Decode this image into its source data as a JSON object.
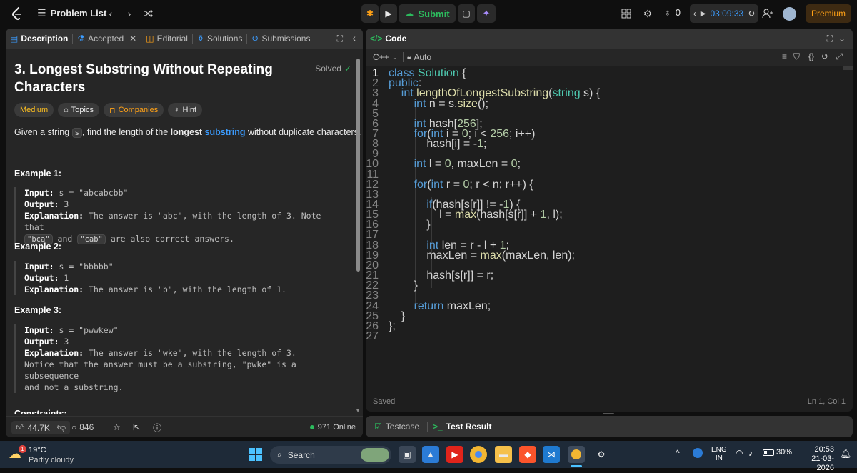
{
  "topbar": {
    "problem_list": "Problem List",
    "submit": "Submit",
    "streak": "0",
    "timer": "03:09:33",
    "premium": "Premium"
  },
  "description_panel": {
    "tabs": [
      {
        "label": "Description"
      },
      {
        "label": "Accepted"
      },
      {
        "label": "Editorial"
      },
      {
        "label": "Solutions"
      },
      {
        "label": "Submissions"
      }
    ],
    "title": "3. Longest Substring Without Repeating Characters",
    "status": "Solved",
    "tags": {
      "difficulty": "Medium",
      "topics": "Topics",
      "companies": "Companies",
      "hint": "Hint"
    },
    "statement": {
      "pre": "Given a string ",
      "var": "s",
      "mid": ", find the length of the ",
      "bold": "longest",
      "link": "substring",
      "post": " without duplicate characters."
    },
    "examples": [
      {
        "title": "Example 1:",
        "input_label": "Input:",
        "input": "s = \"abcabcbb\"",
        "output_label": "Output:",
        "output": "3",
        "explanation_label": "Explanation:",
        "explanation": "The answer is \"abc\", with the length of 3. Note that",
        "code1": "\"bca\"",
        "and": "and",
        "code2": "\"cab\"",
        "tail": "are also correct answers."
      },
      {
        "title": "Example 2:",
        "input_label": "Input:",
        "input": "s = \"bbbbb\"",
        "output_label": "Output:",
        "output": "1",
        "explanation_label": "Explanation:",
        "explanation": "The answer is \"b\", with the length of 1."
      },
      {
        "title": "Example 3:",
        "input_label": "Input:",
        "input": "s = \"pwwkew\"",
        "output_label": "Output:",
        "output": "3",
        "explanation_label": "Explanation:",
        "explanation": "The answer is \"wke\", with the length of 3.",
        "note1": "Notice that the answer must be a substring, \"pwke\" is a subsequence",
        "note2": "and not a substring."
      }
    ],
    "constraints_title": "Constraints:",
    "footer": {
      "likes": "44.7K",
      "comments": "846",
      "online": "971 Online"
    }
  },
  "code_panel": {
    "title": "Code",
    "language": "C++",
    "mode": "Auto",
    "lines": [
      {
        "n": "1",
        "t": "class Solution {"
      },
      {
        "n": "2",
        "t": "public:"
      },
      {
        "n": "3",
        "t": "    int lengthOfLongestSubstring(string s) {"
      },
      {
        "n": "4",
        "t": "        int n = s.size();"
      },
      {
        "n": "5",
        "t": ""
      },
      {
        "n": "6",
        "t": "        int hash[256];"
      },
      {
        "n": "7",
        "t": "        for(int i = 0; i < 256; i++)"
      },
      {
        "n": "8",
        "t": "            hash[i] = -1;"
      },
      {
        "n": "9",
        "t": ""
      },
      {
        "n": "10",
        "t": "        int l = 0, maxLen = 0;"
      },
      {
        "n": "11",
        "t": ""
      },
      {
        "n": "12",
        "t": "        for(int r = 0; r < n; r++) {"
      },
      {
        "n": "13",
        "t": ""
      },
      {
        "n": "14",
        "t": "            if(hash[s[r]] != -1) {"
      },
      {
        "n": "15",
        "t": "                l = max(hash[s[r]] + 1, l);"
      },
      {
        "n": "16",
        "t": "            }"
      },
      {
        "n": "17",
        "t": ""
      },
      {
        "n": "18",
        "t": "            int len = r - l + 1;"
      },
      {
        "n": "19",
        "t": "            maxLen = max(maxLen, len);"
      },
      {
        "n": "20",
        "t": ""
      },
      {
        "n": "21",
        "t": "            hash[s[r]] = r;"
      },
      {
        "n": "22",
        "t": "        }"
      },
      {
        "n": "23",
        "t": ""
      },
      {
        "n": "24",
        "t": "        return maxLen;"
      },
      {
        "n": "25",
        "t": "    }"
      },
      {
        "n": "26",
        "t": "};"
      },
      {
        "n": "27",
        "t": ""
      }
    ],
    "saved": "Saved",
    "cursor": "Ln 1, Col 1"
  },
  "test_panel": {
    "testcase": "Testcase",
    "test_result": "Test Result"
  },
  "taskbar": {
    "weather_temp": "19°C",
    "weather_desc": "Partly cloudy",
    "weather_badge": "1",
    "search": "Search",
    "lang1": "ENG",
    "lang2": "IN",
    "battery": "30%",
    "time": "20:53",
    "date": "21-03-2026"
  }
}
